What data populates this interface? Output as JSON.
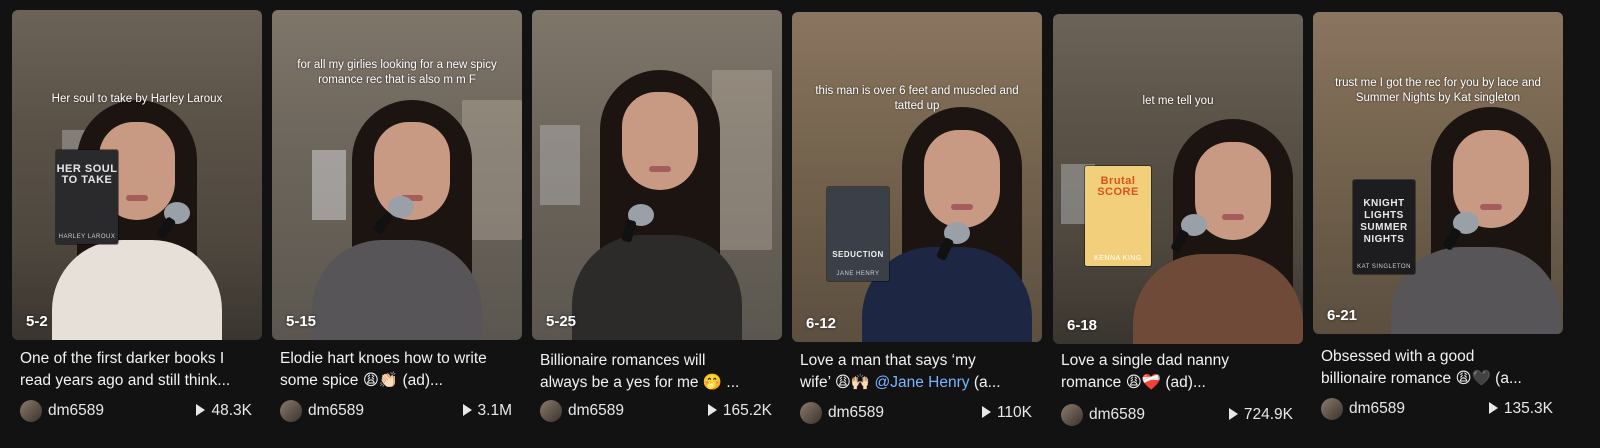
{
  "videos": [
    {
      "overlay": "Her soul to take by Harley Laroux",
      "date": "5-2",
      "caption_line1": "One of the first darker books I",
      "caption_line2": "read years ago and still think...",
      "user": "dm6589",
      "views": "48.3K",
      "book": {
        "title": "HER SOUL TO TAKE",
        "author": "HARLEY LAROUX",
        "color": "#2a2a2c",
        "text_color": "#e6e6e6"
      }
    },
    {
      "overlay": "for all my girlies looking for a new spicy romance rec that is also m m F",
      "date": "5-15",
      "caption_line1": "Elodie hart knoes how to write",
      "caption_line2": "some spice 😩👏🏻 (ad)...",
      "user": "dm6589",
      "views": "3.1M"
    },
    {
      "overlay": "",
      "date": "5-25",
      "caption_line1": "Billionaire romances will",
      "caption_line2": "always be a yes for me 🤭 ...",
      "user": "dm6589",
      "views": "165.2K"
    },
    {
      "overlay": "this man is over 6 feet and muscled and tatted up",
      "date": "6-12",
      "caption_line1": "Love a man that says ‘my",
      "caption_line2_pre": "wife’ 😩🙌🏻 ",
      "caption_mention": "@Jane Henry",
      "caption_line2_post": " (a...",
      "user": "dm6589",
      "views": "110K",
      "book": {
        "title": "SEDUCTION",
        "author": "JANE HENRY",
        "color": "#3a3f48",
        "text_color": "#f0f0f0"
      }
    },
    {
      "overlay": "let me tell you",
      "date": "6-18",
      "caption_line1": "Love a single dad nanny",
      "caption_line2": "romance 😩❤️‍🩹 (ad)...",
      "user": "dm6589",
      "views": "724.9K",
      "book": {
        "title": "Brutal SCORE",
        "author": "KENNA KING",
        "color": "#f2cf7a",
        "text_color": "#d9531e"
      }
    },
    {
      "overlay": "trust me I got the rec for you by lace and Summer Nights by Kat singleton",
      "date": "6-21",
      "caption_line1": "Obsessed with a good",
      "caption_line2": "billionaire romance 😩🖤 (a...",
      "user": "dm6589",
      "views": "135.3K",
      "book": {
        "title": "KNIGHT LIGHTS SUMMER NIGHTS",
        "author": "KAT SINGLETON",
        "color": "#1d1d20",
        "text_color": "#e8e8e8"
      }
    }
  ]
}
